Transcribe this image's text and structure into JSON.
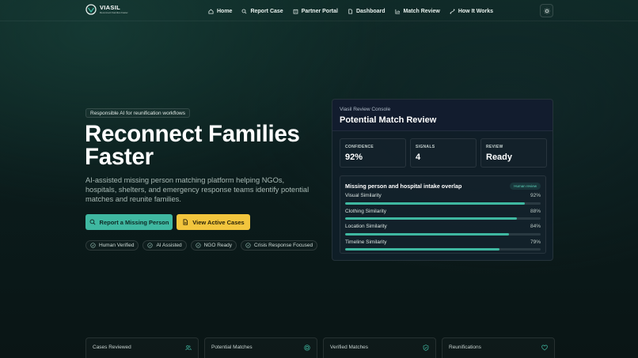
{
  "brand": {
    "name": "VIASIL",
    "tagline": "Reconnect Families Faster"
  },
  "nav": {
    "items": [
      {
        "label": "Home",
        "icon": "home-icon"
      },
      {
        "label": "Report Case",
        "icon": "search-icon"
      },
      {
        "label": "Partner Portal",
        "icon": "building-icon"
      },
      {
        "label": "Dashboard",
        "icon": "file-icon"
      },
      {
        "label": "Match Review",
        "icon": "chart-icon"
      },
      {
        "label": "How It Works",
        "icon": "route-icon"
      }
    ],
    "theme_toggle_icon": "sun-icon"
  },
  "hero": {
    "pill": "Responsible AI for reunification workflows",
    "title": "Reconnect Families Faster",
    "description": "AI-assisted missing person matching platform helping NGOs, hospitals, shelters, and emergency response teams identify potential matches and reunite families.",
    "primary_button": "Report a Missing Person",
    "secondary_button": "View Active Cases",
    "badges": [
      "Human Verified",
      "AI Assisted",
      "NGO Ready",
      "Crisis Response Focused"
    ]
  },
  "console": {
    "label": "Viasil Review Console",
    "title": "Potential Match Review",
    "metrics": [
      {
        "label": "CONFIDENCE",
        "value": "92%"
      },
      {
        "label": "SIGNALS",
        "value": "4"
      },
      {
        "label": "REVIEW",
        "value": "Ready"
      }
    ],
    "overlap": {
      "title": "Missing person and hospital intake overlap",
      "tag": "Human review",
      "similarities": [
        {
          "label": "Visual Similarity",
          "pct": "92%",
          "value": 0.92
        },
        {
          "label": "Clothing Similarity",
          "pct": "88%",
          "value": 0.88
        },
        {
          "label": "Location Similarity",
          "pct": "84%",
          "value": 0.84
        },
        {
          "label": "Timeline Similarity",
          "pct": "79%",
          "value": 0.79
        }
      ]
    }
  },
  "stats": [
    {
      "label": "Cases Reviewed",
      "icon": "users-icon",
      "value": ""
    },
    {
      "label": "Potential Matches",
      "icon": "target-icon",
      "value": ""
    },
    {
      "label": "Verified Matches",
      "icon": "shield-check-icon",
      "value": ""
    },
    {
      "label": "Reunifications",
      "icon": "heart-icon",
      "value": ""
    }
  ],
  "colors": {
    "accent": "#3fb8a1",
    "highlight": "#f2c53d",
    "background": "#0b1c1c"
  }
}
